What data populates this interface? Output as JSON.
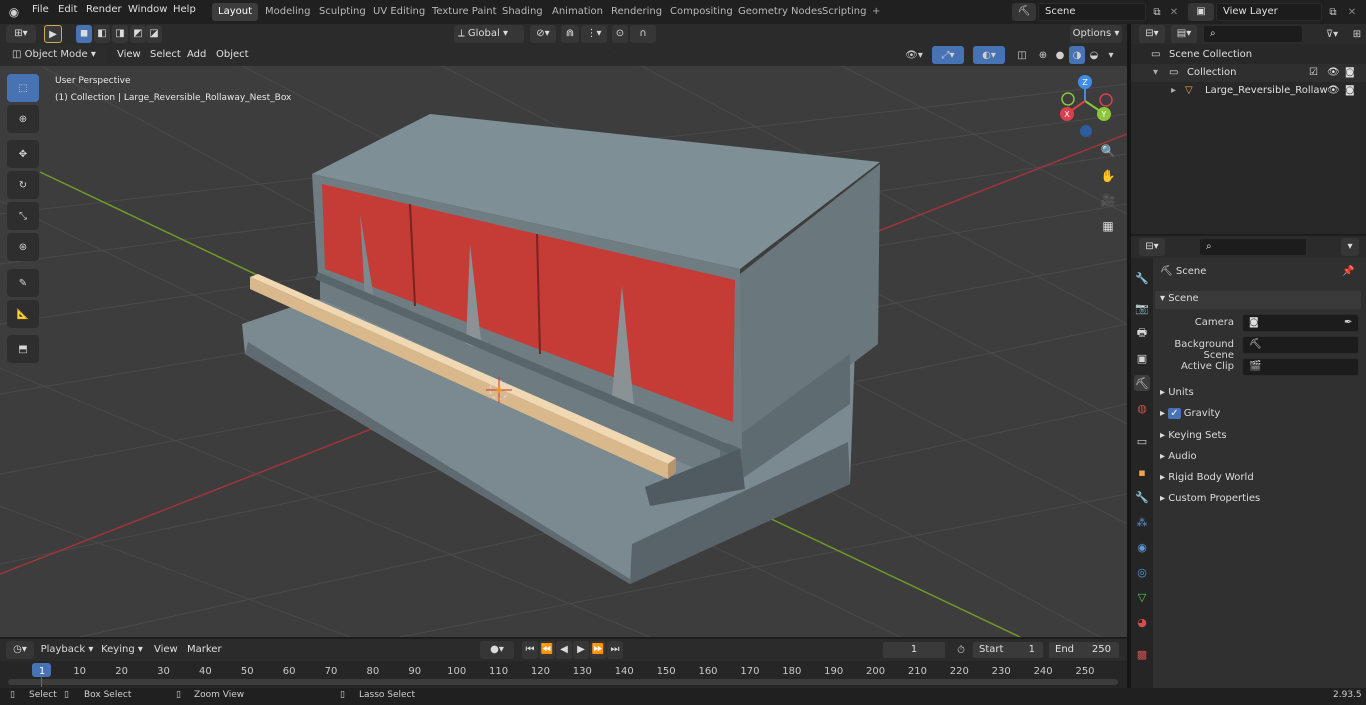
{
  "menu": {
    "items": [
      "File",
      "Edit",
      "Render",
      "Window",
      "Help"
    ]
  },
  "workspaces": {
    "tabs": [
      "Layout",
      "Modeling",
      "Sculpting",
      "UV Editing",
      "Texture Paint",
      "Shading",
      "Animation",
      "Rendering",
      "Compositing",
      "Geometry Nodes",
      "Scripting"
    ],
    "active": "Layout"
  },
  "scene": {
    "name": "Scene",
    "view_layer": "View Layer"
  },
  "viewport_header": {
    "mode": "Object Mode",
    "menus": [
      "View",
      "Select",
      "Add",
      "Object"
    ],
    "transform": "Global",
    "options": "Options"
  },
  "viewport": {
    "perspective": "User Perspective",
    "collection_info": "(1) Collection | Large_Reversible_Rollaway_Nest_Box",
    "gizmo": {
      "z": "Z",
      "y": "Y",
      "x": "X"
    }
  },
  "outliner": {
    "root": "Scene Collection",
    "collection": "Collection",
    "object": "Large_Reversible_Rollaw"
  },
  "properties": {
    "context": "Scene",
    "section": "Scene",
    "fields": [
      {
        "label": "Camera",
        "value": ""
      },
      {
        "label": "Background Scene",
        "value": ""
      },
      {
        "label": "Active Clip",
        "value": ""
      }
    ],
    "panels": [
      "Units",
      "Gravity",
      "Keying Sets",
      "Audio",
      "Rigid Body World",
      "Custom Properties"
    ],
    "gravity_checked": true
  },
  "timeline": {
    "menus": [
      "Playback",
      "Keying",
      "View",
      "Marker"
    ],
    "current_frame": "1",
    "start_label": "Start",
    "start": "1",
    "end_label": "End",
    "end": "250",
    "ruler": [
      "1",
      "10",
      "20",
      "30",
      "40",
      "50",
      "60",
      "70",
      "80",
      "90",
      "100",
      "110",
      "120",
      "130",
      "140",
      "150",
      "160",
      "170",
      "180",
      "190",
      "200",
      "210",
      "220",
      "230",
      "240",
      "250"
    ]
  },
  "status": {
    "select": "Select",
    "box_select": "Box Select",
    "zoom_view": "Zoom View",
    "lasso_select": "Lasso Select",
    "version": "2.93.5"
  },
  "colors": {
    "accent": "#4772b3",
    "red_panel": "#c53b35",
    "metal": "#7d8c92",
    "wood": "#e6c9a0",
    "x_axis": "#d9404d",
    "y_axis": "#8ac73b",
    "z_axis": "#3f8be8"
  }
}
